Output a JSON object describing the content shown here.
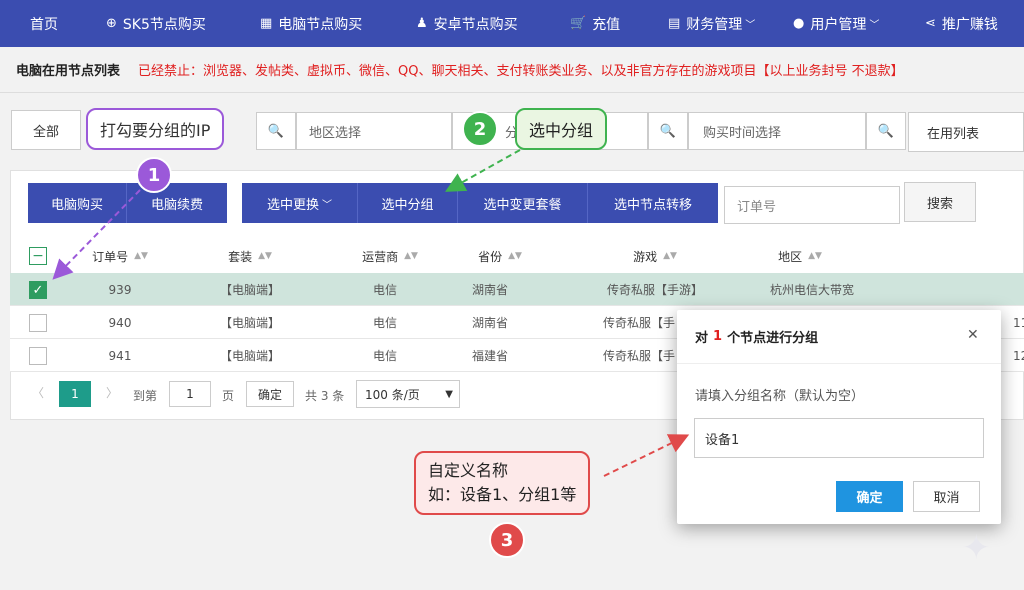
{
  "nav": {
    "items": [
      {
        "label": "首页",
        "icon": ""
      },
      {
        "label": "SK5节点购买",
        "icon": "⊕"
      },
      {
        "label": "电脑节点购买",
        "icon": "▦"
      },
      {
        "label": "安卓节点购买",
        "icon": "♟"
      },
      {
        "label": "充值",
        "icon": "🛒"
      },
      {
        "label": "财务管理",
        "icon": "▤",
        "chevron": "﹀"
      },
      {
        "label": "用户管理",
        "icon": "●",
        "chevron": "﹀"
      },
      {
        "label": "推广赚钱",
        "icon": "⋖"
      }
    ]
  },
  "notice": {
    "title": "电脑在用节点列表",
    "text": "已经禁止：浏览器、发帖类、虚拟币、微信、QQ、聊天相关、支付转账类业务、以及非官方存在的游戏项目【以上业务封号 不退款】"
  },
  "filters": {
    "all": "全部",
    "region_placeholder": "地区选择",
    "time_placeholder": "购买时间选择",
    "in_use": "在用列表",
    "partial_text": "分"
  },
  "toolbar": {
    "buy": "电脑购买",
    "renew": "电脑续费",
    "change": "选中更换",
    "change_chevron": "﹀",
    "group": "选中分组",
    "change_package": "选中变更套餐",
    "transfer": "选中节点转移",
    "order_placeholder": "订单号",
    "search": "搜索"
  },
  "table": {
    "headers": [
      "订单号",
      "套装",
      "运营商",
      "省份",
      "游戏",
      "地区"
    ],
    "rows": [
      {
        "id": "939",
        "pkg": "【电脑端】",
        "isp": "电信",
        "prov": "湖南省",
        "game": "传奇私服【手游】",
        "region": "杭州电信大带宽",
        "extra": "",
        "checked": true
      },
      {
        "id": "940",
        "pkg": "【电脑端】",
        "isp": "电信",
        "prov": "湖南省",
        "game": "传奇私服【手",
        "region": "",
        "extra": "11",
        "checked": false
      },
      {
        "id": "941",
        "pkg": "【电脑端】",
        "isp": "电信",
        "prov": "福建省",
        "game": "传奇私服【手",
        "region": "",
        "extra": "12",
        "checked": false
      }
    ]
  },
  "pager": {
    "prev": "〈",
    "current": "1",
    "next": "〉",
    "goto": "到第",
    "page_input": "1",
    "page_unit": "页",
    "confirm": "确定",
    "total": "共 3 条",
    "per_page": "100 条/页"
  },
  "modal": {
    "title_prefix": "对",
    "title_count": "1",
    "title_suffix": "个节点进行分组",
    "close": "✕",
    "label": "请填入分组名称（默认为空）",
    "input_value": "设备1",
    "ok": "确定",
    "cancel": "取消"
  },
  "annotations": {
    "step1_text": "打勾要分组的IP",
    "step1_num": "1",
    "step2_text": "选中分组",
    "step2_num": "2",
    "step3_line1": "自定义名称",
    "step3_line2": "如：设备1、分组1等",
    "step3_num": "3"
  },
  "colors": {
    "nav": "#3b4db0",
    "notice_red": "#e02020",
    "selected_row": "#cfe4dc",
    "checkbox_green": "#2e9c60",
    "primary_btn": "#1f94e0",
    "step1": "#9b59d9",
    "step2": "#3fb34f",
    "step3": "#e04a4a"
  }
}
